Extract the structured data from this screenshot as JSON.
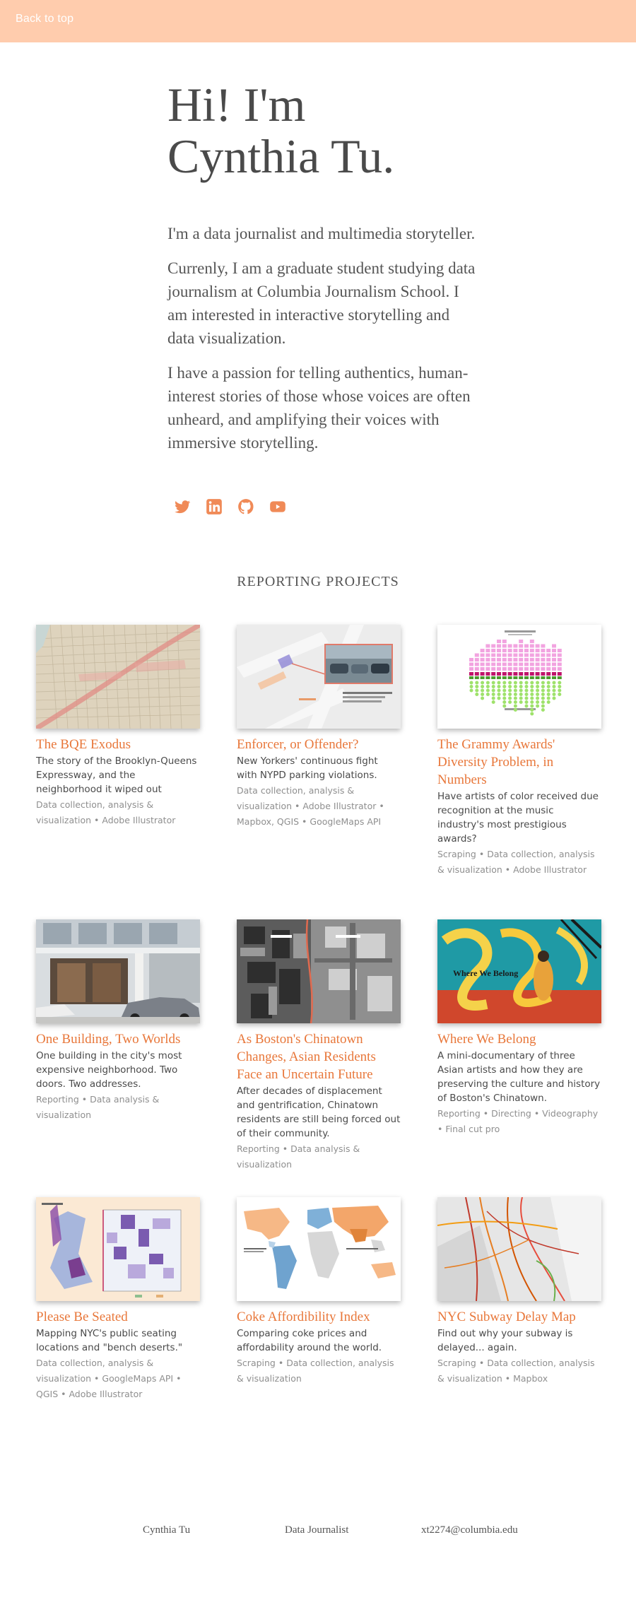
{
  "nav": {
    "back_to_top": "Back to top"
  },
  "hero": {
    "title_line1": "Hi! I'm",
    "title_line2": "Cynthia Tu."
  },
  "intro": {
    "p1": "I'm a data journalist and multimedia storyteller.",
    "p2": "Currenly, I am a graduate student studying data journalism at Columbia Journalism School. I am interested in interactive storytelling and data visualization.",
    "p3": "I have a passion for telling authentics, human-interest stories of those whose voices are often unheard, and amplifying their voices with immersive storytelling."
  },
  "social": [
    {
      "icon": "twitter-icon"
    },
    {
      "icon": "linkedin-icon"
    },
    {
      "icon": "github-icon"
    },
    {
      "icon": "youtube-icon"
    }
  ],
  "accent_color": "#e8773a",
  "topbar_color": "#ffccad",
  "section": {
    "title": "REPORTING PROJECTS"
  },
  "projects": [
    {
      "title": "The BQE Exodus",
      "desc": "The story of the Brooklyn-Queens Expressway, and the neighborhood it wiped out",
      "tags": "Data collection, analysis & visualization • Adobe Illustrator"
    },
    {
      "title": "Enforcer, or Offender?",
      "desc": "New Yorkers' continuous fight with NYPD parking violations.",
      "tags": "Data collection, analysis & visualization • Adobe Illustrator • Mapbox, QGIS • GoogleMaps API"
    },
    {
      "title": "The Grammy Awards' Diversity Problem, in Numbers",
      "desc": "Have artists of color received due recognition at the music industry's most prestigious awards?",
      "tags": "Scraping • Data collection, analysis & visualization • Adobe Illustrator"
    },
    {
      "title": "One Building, Two Worlds",
      "desc": "One building in the city's most expensive neighborhood. Two doors. Two addresses.",
      "tags": "Reporting • Data analysis & visualization"
    },
    {
      "title": "As Boston's Chinatown Changes, Asian Residents Face an Uncertain Future",
      "desc": "After decades of displacement and gentrification, Chinatown residents are still being forced out of their community.",
      "tags": "Reporting • Data analysis & visualization"
    },
    {
      "title": "Where We Belong",
      "desc": "A mini-documentary of three Asian artists and how they are preserving the culture and history of Boston's Chinatown.",
      "tags": "Reporting • Directing • Videography • Final cut pro",
      "thumb_caption": "Where We Belong"
    },
    {
      "title": "Please Be Seated",
      "desc": "Mapping NYC's public seating locations and \"bench deserts.\"",
      "tags": "Data collection, analysis & visualization • GoogleMaps API • QGIS • Adobe Illustrator"
    },
    {
      "title": "Coke Affordibility Index",
      "desc": "Comparing coke prices and affordability around the world.",
      "tags": "Scraping • Data collection, analysis & visualization"
    },
    {
      "title": "NYC Subway Delay Map",
      "desc": "Find out why your subway is delayed... again.",
      "tags": "Scraping • Data collection, analysis & visualization • Mapbox"
    }
  ],
  "footer": {
    "name": "Cynthia Tu",
    "role": "Data Journalist",
    "email": "xt2274@columbia.edu"
  }
}
